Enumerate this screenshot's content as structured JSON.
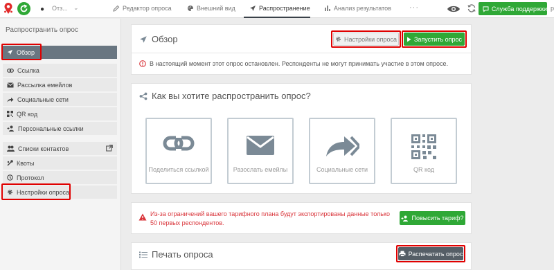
{
  "topbar": {
    "survey_name": "Отз...",
    "tabs": [
      {
        "label": "Редактор опроса"
      },
      {
        "label": "Внешний вид"
      },
      {
        "label": "Распространение"
      },
      {
        "label": "Анализ результатов"
      }
    ],
    "more": "···",
    "support_label": "Служба поддержки",
    "cut_letter": "р"
  },
  "sidebar": {
    "title": "Распространить опрос",
    "items": [
      {
        "label": "Обзор"
      },
      {
        "label": "Ссылка"
      },
      {
        "label": "Рассылка емейлов"
      },
      {
        "label": "Социальные сети"
      },
      {
        "label": "QR код"
      },
      {
        "label": "Персональные ссылки"
      },
      {
        "label": "Списки контактов"
      },
      {
        "label": "Квоты"
      },
      {
        "label": "Протокол"
      },
      {
        "label": "Настройки опроса"
      }
    ]
  },
  "overview": {
    "title": "Обзор",
    "settings_label": "Настройки опроса",
    "launch_label": "Запустить опрос",
    "stopped_message": "В настоящий момент этот опрос остановлен. Респонденты не могут принимать участие в этом опросе."
  },
  "share": {
    "title": "Как вы хотите распространить опрос?",
    "options": [
      {
        "label": "Поделиться ссылкой"
      },
      {
        "label": "Разослать емейлы"
      },
      {
        "label": "Социальные сети"
      },
      {
        "label": "QR код"
      }
    ]
  },
  "limit": {
    "message": "Из-за ограничений вашего тарифного плана будут экспортированы данные только 50 первых респондентов.",
    "upgrade_label": "Повысить тариф?"
  },
  "print": {
    "title": "Печать опроса",
    "button_label": "Распечатать опрос"
  },
  "colors": {
    "accent_green": "#2fa836",
    "highlight_red": "#e00000",
    "active_sidebar": "#697681",
    "warning_red": "#d9343a",
    "tile_border": "#c3ccd3",
    "icon_grey": "#7b8a96"
  }
}
